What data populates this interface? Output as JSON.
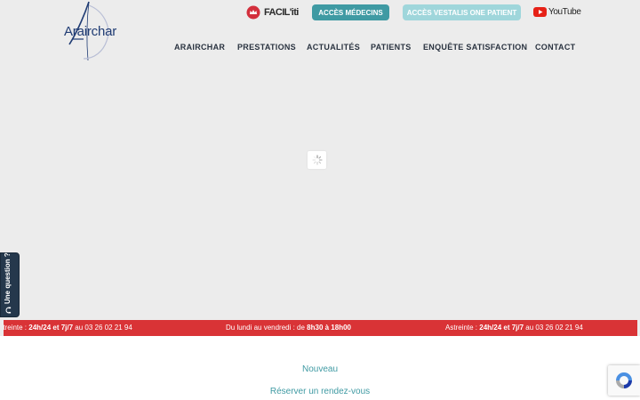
{
  "header": {
    "logo_text": "Arairchar",
    "facilti_label": "FACIL'iti",
    "buttons": {
      "medecins": "ACCÈS MÉDECINS",
      "vestalis": "ACCÈS VESTALIS ONE PATIENT"
    },
    "youtube_label": "YouTube"
  },
  "nav": {
    "items": [
      {
        "label": "ARAIRCHAR"
      },
      {
        "label": "PRESTATIONS"
      },
      {
        "label": "ACTUALITÉS"
      },
      {
        "label": "PATIENTS"
      },
      {
        "label": "ENQUÊTE SATISFACTION"
      },
      {
        "label": "CONTACT"
      }
    ]
  },
  "question_tab": {
    "label": "Une question ?"
  },
  "ticker": {
    "items": [
      {
        "prefix": "Astreinte : ",
        "bold": "24h/24 et 7j/7",
        "suffix": " au 03 26 02 21 94"
      },
      {
        "prefix": "Du lundi au vendredi : de ",
        "bold": "8h30 à 18h00",
        "suffix": ""
      },
      {
        "prefix": "Astreinte : ",
        "bold": "24h/24 et 7j/7",
        "suffix": " au 03 26 02 21 94"
      }
    ]
  },
  "main": {
    "nouveau_label": "Nouveau",
    "rdv_label": "Réserver un rendez-vous"
  },
  "colors": {
    "accent_teal": "#3f9aa3",
    "accent_light_teal": "#9fd6db",
    "ticker_red": "#d93336",
    "navy": "#25384c"
  }
}
